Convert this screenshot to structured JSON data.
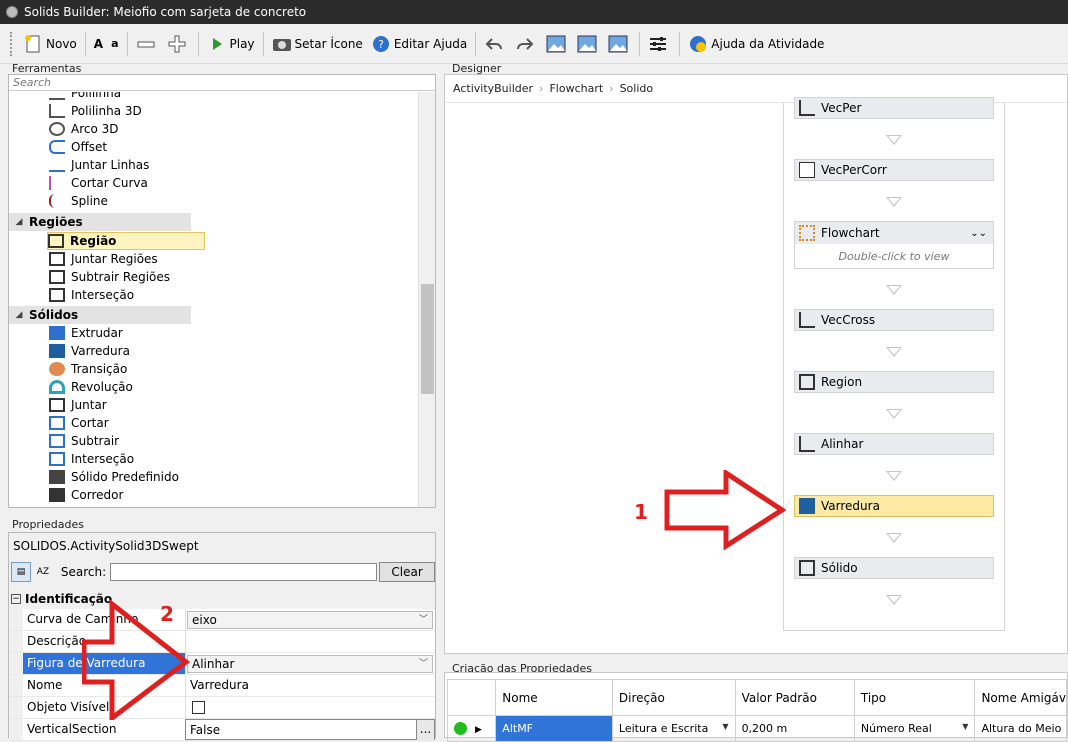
{
  "window": {
    "title": "Solids Builder: Meiofio com sarjeta de concreto"
  },
  "toolbar": {
    "novo": "Novo",
    "font_a_big": "A",
    "font_a_small": "a",
    "play": "Play",
    "setar_icone": "Setar Ícone",
    "editar_ajuda": "Editar Ajuda",
    "ajuda_atividade": "Ajuda da Atividade"
  },
  "tools_panel": {
    "label": "Ferramentas",
    "search_placeholder": "Search",
    "items_top": [
      "Polilinha",
      "Polilinha 3D",
      "Arco 3D",
      "Offset",
      "Juntar Linhas",
      "Cortar Curva",
      "Spline"
    ],
    "group_regioes": "Regiões",
    "items_regioes": [
      "Região",
      "Juntar Regiões",
      "Subtrair Regiões",
      "Interseção"
    ],
    "group_solidos": "Sólidos",
    "items_solidos": [
      "Extrudar",
      "Varredura",
      "Transição",
      "Revolução",
      "Juntar",
      "Cortar",
      "Subtrair",
      "Interseção",
      "Sólido Predefinido",
      "Corredor"
    ]
  },
  "properties_panel": {
    "label": "Propriedades",
    "type_name": "SOLIDOS.ActivitySolid3DSwept",
    "search_label": "Search:",
    "clear_button": "Clear",
    "category": "Identificação",
    "rows": [
      {
        "name": "Curva de Caminho",
        "value": "eixo"
      },
      {
        "name": "Descrição",
        "value": ""
      },
      {
        "name": "Figura de Varredura",
        "value": "Alinhar"
      },
      {
        "name": "Nome",
        "value": "Varredura"
      },
      {
        "name": "Objeto Visível",
        "value": ""
      },
      {
        "name": "VerticalSection",
        "value": "False"
      }
    ],
    "ellipsis": "..."
  },
  "designer": {
    "label": "Designer",
    "breadcrumb": [
      "ActivityBuilder",
      "Flowchart",
      "Solido"
    ],
    "activities": [
      "VecPer",
      "VecPerCorr",
      "Flowchart",
      "VecCross",
      "Region",
      "Alinhar",
      "Varredura",
      "Sólido"
    ],
    "flowchart_hint": "Double-click to view"
  },
  "creation_panel": {
    "label": "Criação das Propriedades",
    "columns": [
      "Nome",
      "Direção",
      "Valor Padrão",
      "Tipo",
      "Nome Amigáv"
    ],
    "rows": [
      {
        "nome": "AltMF",
        "direcao": "Leitura e Escrita",
        "valor": "0,200 m",
        "tipo": "Número Real",
        "amigavel": "Altura do Meio"
      }
    ]
  },
  "annotations": {
    "label1": "1",
    "label2": "2"
  },
  "colors": {
    "arrow_red": "#e02020",
    "selection_blue": "#3074d7",
    "highlight_yellow": "#fce9a4"
  }
}
